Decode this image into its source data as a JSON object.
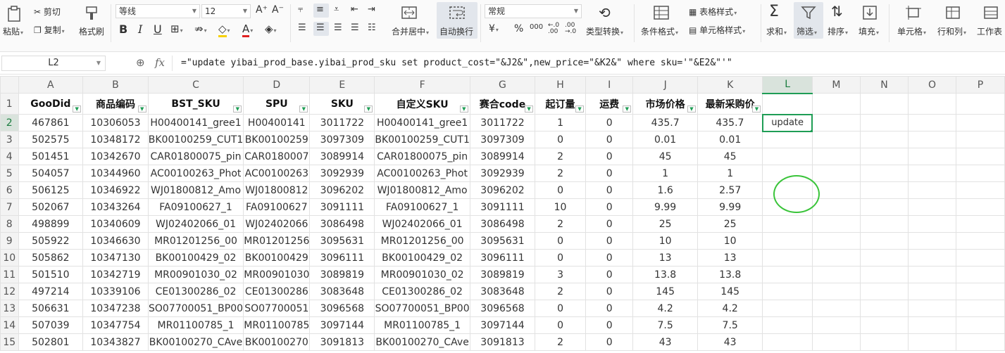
{
  "ribbon": {
    "paste": "粘贴",
    "cut": "剪切",
    "copy": "复制",
    "format_painter": "格式刷",
    "font_name": "等线",
    "font_size": "12",
    "merge_center": "合并居中",
    "wrap_text": "自动换行",
    "number_format": "常规",
    "type_convert": "类型转换",
    "conditional_format": "条件格式",
    "table_style": "表格样式",
    "cell_style": "单元格样式",
    "sum": "求和",
    "filter": "筛选",
    "sort": "排序",
    "fill": "填充",
    "cell": "单元格",
    "row_col": "行和列",
    "worksheet": "工作表"
  },
  "formula_bar": {
    "name_box": "L2",
    "fx": "fx",
    "formula": "=\"update yibai_prod_base.yibai_prod_sku set product_cost=\"&J2&\",new_price=\"&K2&\" where sku='\"&E2&\"'\""
  },
  "sheet": {
    "columns": [
      "A",
      "B",
      "C",
      "D",
      "E",
      "F",
      "G",
      "H",
      "I",
      "J",
      "K",
      "L",
      "M",
      "N",
      "O",
      "P"
    ],
    "headers": [
      "GooDid",
      "商品编码",
      "BST_SKU",
      "SPU",
      "SKU",
      "自定义SKU",
      "赛合code",
      "起订量",
      "运费",
      "市场价格",
      "最新采购价",
      "",
      "",
      "",
      "",
      ""
    ],
    "rows": [
      [
        "467861",
        "10306053",
        "H00400141_gree1",
        "H00400141",
        "3011722",
        "H00400141_gree1",
        "3011722",
        "1",
        "0",
        "435.7",
        "435.7",
        "update"
      ],
      [
        "502575",
        "10348172",
        "BK00100259_CUT1",
        "BK00100259",
        "3097309",
        "BK00100259_CUT1",
        "3097309",
        "0",
        "0",
        "0.01",
        "0.01",
        ""
      ],
      [
        "501451",
        "10342670",
        "CAR01800075_pin",
        "CAR0180007",
        "3089914",
        "CAR01800075_pin",
        "3089914",
        "2",
        "0",
        "45",
        "45",
        ""
      ],
      [
        "504057",
        "10344960",
        "AC00100263_Phot",
        "AC00100263",
        "3092939",
        "AC00100263_Phot",
        "3092939",
        "2",
        "0",
        "1",
        "1",
        ""
      ],
      [
        "506125",
        "10346922",
        "WJ01800812_Amo",
        "WJ01800812",
        "3096202",
        "WJ01800812_Amo",
        "3096202",
        "0",
        "0",
        "1.6",
        "2.57",
        ""
      ],
      [
        "502067",
        "10343264",
        "FA09100627_1",
        "FA09100627",
        "3091111",
        "FA09100627_1",
        "3091111",
        "10",
        "0",
        "9.99",
        "9.99",
        ""
      ],
      [
        "498899",
        "10340609",
        "WJ02402066_01",
        "WJ02402066",
        "3086498",
        "WJ02402066_01",
        "3086498",
        "2",
        "0",
        "25",
        "25",
        ""
      ],
      [
        "505922",
        "10346630",
        "MR01201256_00",
        "MR01201256",
        "3095631",
        "MR01201256_00",
        "3095631",
        "0",
        "0",
        "10",
        "10",
        ""
      ],
      [
        "505862",
        "10347130",
        "BK00100429_02",
        "BK00100429",
        "3096111",
        "BK00100429_02",
        "3096111",
        "0",
        "0",
        "13",
        "13",
        ""
      ],
      [
        "501510",
        "10342719",
        "MR00901030_02",
        "MR00901030",
        "3089819",
        "MR00901030_02",
        "3089819",
        "3",
        "0",
        "13.8",
        "13.8",
        ""
      ],
      [
        "497214",
        "10339106",
        "CE01300286_02",
        "CE01300286",
        "3083648",
        "CE01300286_02",
        "3083648",
        "2",
        "0",
        "145",
        "145",
        ""
      ],
      [
        "506631",
        "10347238",
        "SO07700051_BP00",
        "SO07700051",
        "3096568",
        "SO07700051_BP00",
        "3096568",
        "0",
        "0",
        "4.2",
        "4.2",
        ""
      ],
      [
        "507039",
        "10347754",
        "MR01100785_1",
        "MR01100785",
        "3097144",
        "MR01100785_1",
        "3097144",
        "0",
        "0",
        "7.5",
        "7.5",
        ""
      ],
      [
        "502801",
        "10343827",
        "BK00100270_CAve",
        "BK00100270",
        "3091813",
        "BK00100270_CAve",
        "3091813",
        "2",
        "0",
        "43",
        "43",
        ""
      ]
    ]
  },
  "colors": {
    "accent": "#1f9d55",
    "annotation_circle": "#3ac43a"
  }
}
